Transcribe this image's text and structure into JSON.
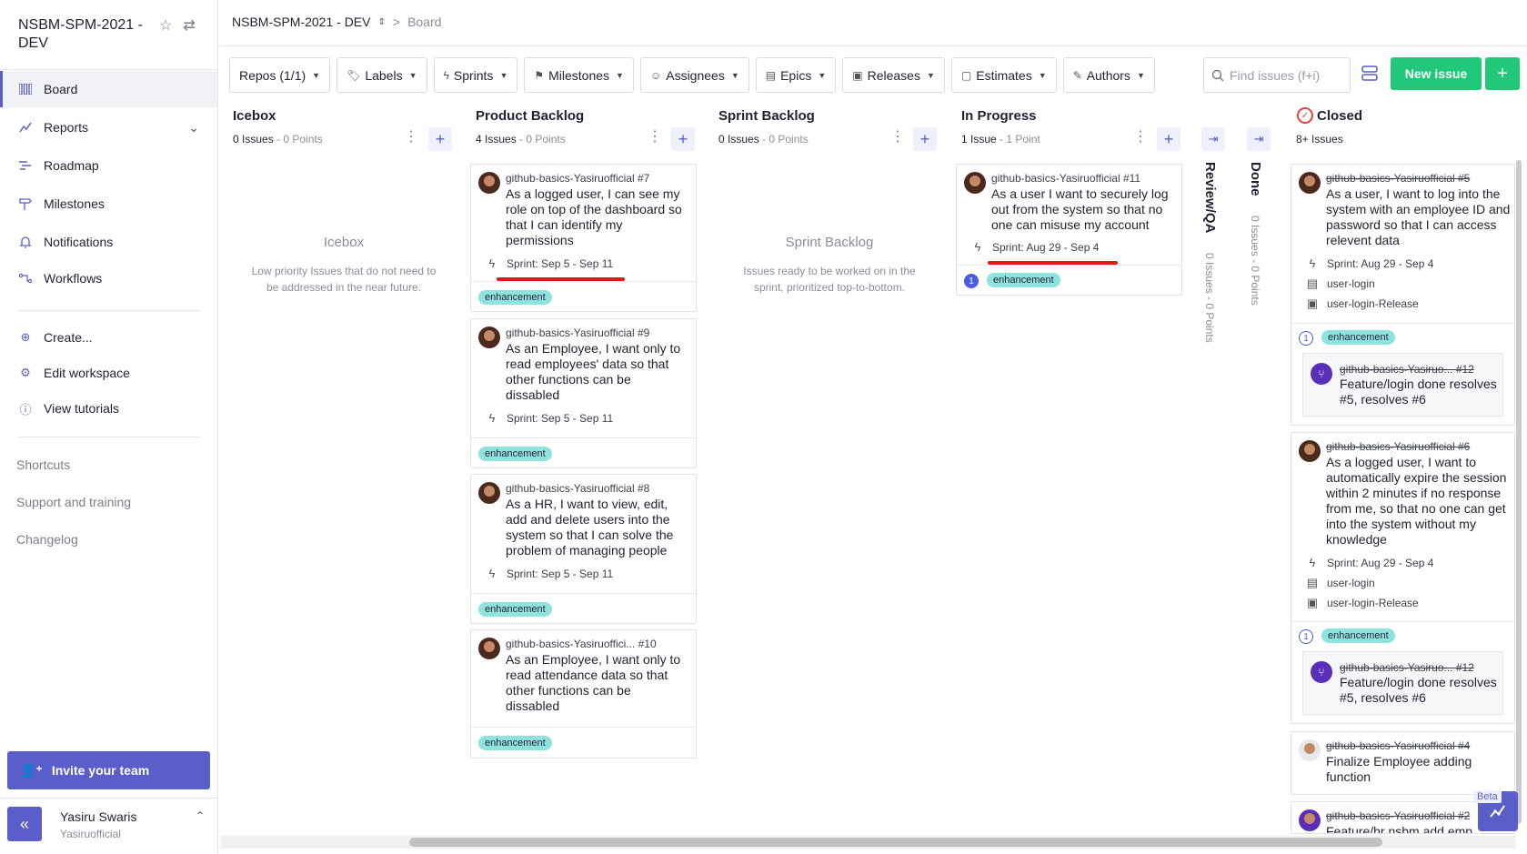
{
  "workspace": {
    "title": "NSBM-SPM-2021 - DEV"
  },
  "breadcrumb": {
    "repo": "NSBM-SPM-2021 - DEV",
    "sep": ">",
    "page": "Board"
  },
  "sidebar": {
    "items": [
      {
        "label": "Board",
        "icon": "board-icon"
      },
      {
        "label": "Reports",
        "icon": "reports-icon"
      },
      {
        "label": "Roadmap",
        "icon": "roadmap-icon"
      },
      {
        "label": "Milestones",
        "icon": "milestones-icon"
      },
      {
        "label": "Notifications",
        "icon": "bell-icon"
      },
      {
        "label": "Workflows",
        "icon": "workflows-icon"
      }
    ],
    "actions": [
      {
        "label": "Create..."
      },
      {
        "label": "Edit workspace"
      },
      {
        "label": "View tutorials"
      }
    ],
    "links": [
      {
        "label": "Shortcuts"
      },
      {
        "label": "Support and training"
      },
      {
        "label": "Changelog"
      }
    ],
    "invite": "Invite your team",
    "user": {
      "name": "Yasiru Swaris",
      "handle": "Yasiruofficial"
    }
  },
  "toolbar": {
    "filters": [
      "Repos (1/1)",
      "Labels",
      "Sprints",
      "Milestones",
      "Assignees",
      "Epics",
      "Releases",
      "Estimates",
      "Authors"
    ],
    "search_placeholder": "Find issues (f+i)",
    "new_issue": "New issue",
    "plus": "+"
  },
  "pipelines": {
    "icebox": {
      "title": "Icebox",
      "issues": "0 Issues",
      "points": " - 0 Points",
      "empty_title": "Icebox",
      "empty_desc": "Low priority Issues that do not need to be addressed in the near future."
    },
    "product_backlog": {
      "title": "Product Backlog",
      "issues": "4 Issues",
      "points": " - 0 Points"
    },
    "sprint_backlog": {
      "title": "Sprint Backlog",
      "issues": "0 Issues",
      "points": " - 0 Points",
      "empty_title": "Sprint Backlog",
      "empty_desc": "Issues ready to be worked on in the sprint, prioritized top-to-bottom."
    },
    "in_progress": {
      "title": "In Progress",
      "issues": "1 Issue",
      "points": " - 1 Point"
    },
    "review_qa": {
      "title": "Review/QA",
      "meta": "0 Issues - 0 Points"
    },
    "done": {
      "title": "Done",
      "meta": "0 Issues - 0 Points"
    },
    "closed": {
      "title": "Closed",
      "issues": "8+ Issues"
    }
  },
  "cards": {
    "pb1": {
      "ref": "github-basics-Yasiruofficial #7",
      "title": "As a logged user, I can see my role on top of the dashboard so that I can identify my permissions",
      "sprint": "Sprint: Sep 5 - Sep 11",
      "label": "enhancement"
    },
    "pb2": {
      "ref": "github-basics-Yasiruofficial #9",
      "title": "As an Employee, I want only to read employees' data so that other functions can be dissabled",
      "sprint": "Sprint: Sep 5 - Sep 11",
      "label": "enhancement"
    },
    "pb3": {
      "ref": "github-basics-Yasiruofficial #8",
      "title": "As a HR, I want to view, edit, add and delete users into the system so that I can solve the problem of managing people",
      "sprint": "Sprint: Sep 5 - Sep 11",
      "label": "enhancement"
    },
    "pb4": {
      "ref": "github-basics-Yasiruoffici... #10",
      "title": "As an Employee, I want only to read attendance data so that other functions can be dissabled",
      "label": "enhancement"
    },
    "ip1": {
      "ref": "github-basics-Yasiruofficial #11",
      "title": "As a user I want to securely log out from the system so that no one can misuse my account",
      "sprint": "Sprint: Aug 29 - Sep 4",
      "count": "1",
      "label": "enhancement"
    },
    "c1": {
      "ref": "github-basics-Yasiruofficial #5",
      "title": "As a user, I want to log into the system with an employee ID and password so that I can access relevent data",
      "sprint": "Sprint: Aug 29 - Sep 4",
      "milestone": "user-login",
      "release": "user-login-Release",
      "count": "1",
      "label": "enhancement",
      "pr_ref": "github-basics-Yasiruo... #12",
      "pr_title": "Feature/login done resolves #5, resolves #6"
    },
    "c2": {
      "ref": "github-basics-Yasiruofficial #6",
      "title": "As a logged user, I want to automatically expire the session within 2 minutes if no response from me, so that no one can get into the system without my knowledge",
      "sprint": "Sprint: Aug 29 - Sep 4",
      "milestone": "user-login",
      "release": "user-login-Release",
      "count": "1",
      "label": "enhancement",
      "pr_ref": "github-basics-Yasiruo... #12",
      "pr_title": "Feature/login done resolves #5, resolves #6"
    },
    "c3": {
      "ref": "github-basics-Yasiruofficial #4",
      "title": "Finalize Employee adding function"
    },
    "c4": {
      "ref": "github-basics-Yasiruofficial #2",
      "title": "Feature/hr nsbm add emp"
    }
  },
  "beta": "Beta",
  "colors": {
    "accent": "#5a5ec8",
    "new_issue": "#22c87a",
    "label": "#8fe3df",
    "annotation_red": "#e8141a"
  }
}
